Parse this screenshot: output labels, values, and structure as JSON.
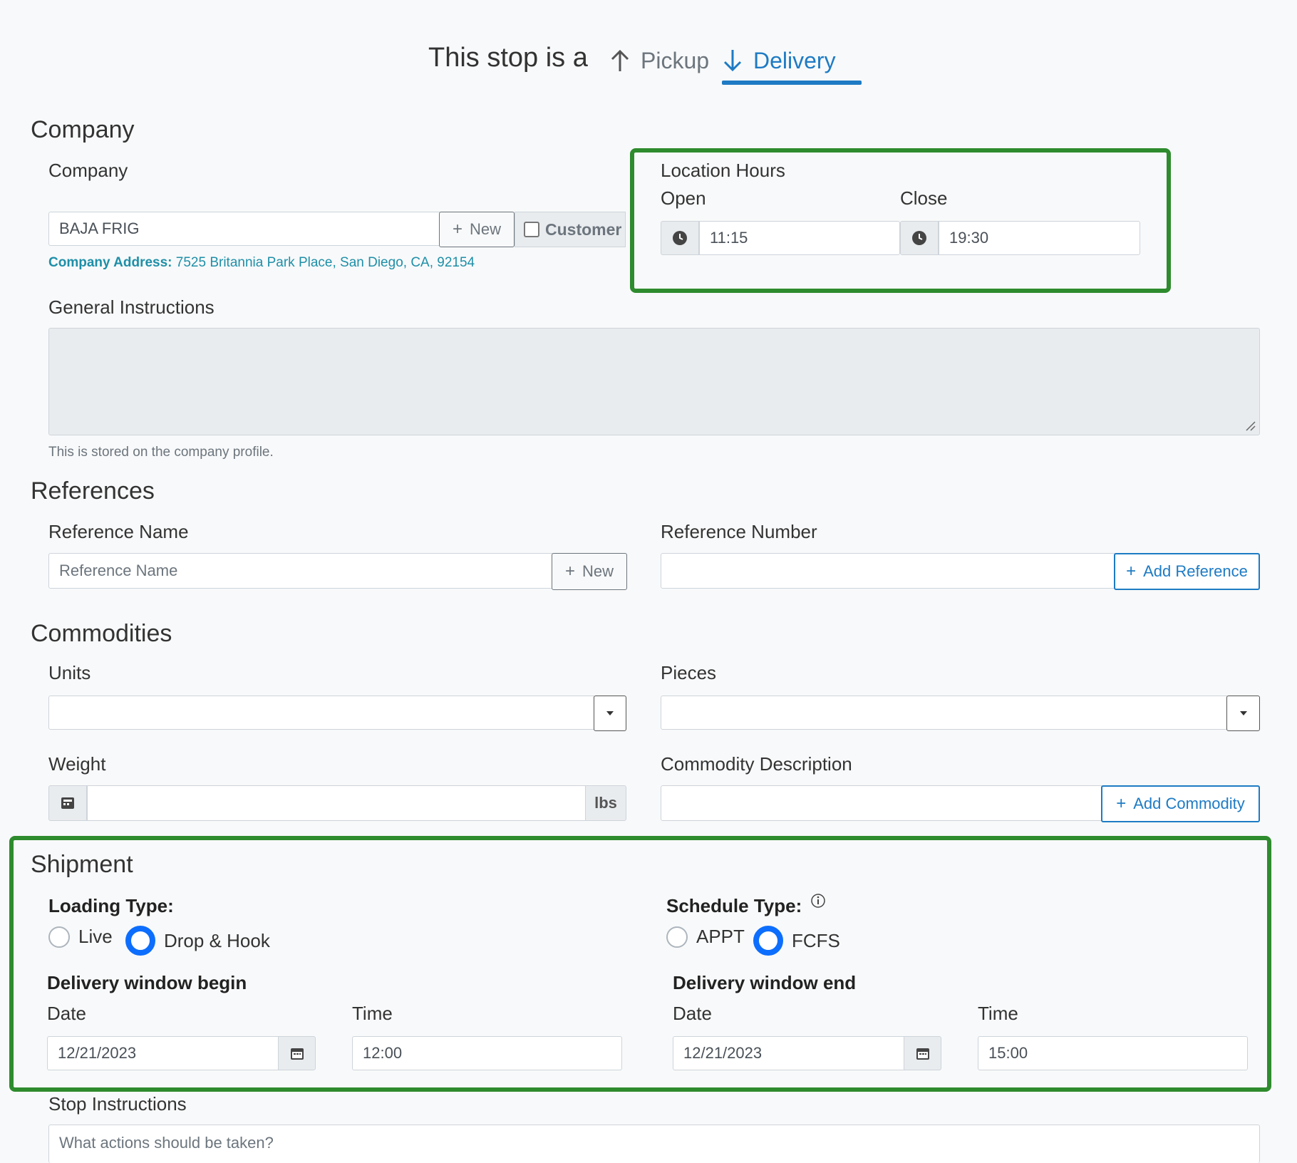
{
  "header": {
    "prefix": "This stop is a",
    "pickup_label": "Pickup",
    "delivery_label": "Delivery"
  },
  "company": {
    "section_title": "Company",
    "field_label": "Company",
    "value": "BAJA FRIG",
    "new_label": "New",
    "customer_label": "Customer",
    "address_label": "Company Address:",
    "address_value": "7525 Britannia Park Place, San Diego, CA, 92154"
  },
  "location_hours": {
    "title": "Location Hours",
    "open_label": "Open",
    "close_label": "Close",
    "open_value": "11:15",
    "close_value": "19:30"
  },
  "general_instructions": {
    "label": "General Instructions",
    "help": "This is stored on the company profile."
  },
  "references": {
    "section_title": "References",
    "name_label": "Reference Name",
    "name_placeholder": "Reference Name",
    "new_label": "New",
    "number_label": "Reference Number",
    "add_label": "Add Reference"
  },
  "commodities": {
    "section_title": "Commodities",
    "units_label": "Units",
    "pieces_label": "Pieces",
    "weight_label": "Weight",
    "weight_unit": "lbs",
    "description_label": "Commodity Description",
    "add_label": "Add Commodity"
  },
  "shipment": {
    "section_title": "Shipment",
    "loading_type_label": "Loading Type:",
    "loading_options": [
      "Live",
      "Drop & Hook"
    ],
    "loading_selected": "Drop & Hook",
    "schedule_type_label": "Schedule Type:",
    "schedule_options": [
      "APPT",
      "FCFS"
    ],
    "schedule_selected": "FCFS",
    "window_begin_label": "Delivery window begin",
    "window_end_label": "Delivery window end",
    "date_label": "Date",
    "time_label": "Time",
    "begin_date": "12/21/2023",
    "begin_time": "12:00",
    "end_date": "12/21/2023",
    "end_time": "15:00"
  },
  "stop_instructions": {
    "label": "Stop Instructions",
    "placeholder": "What actions should be taken?"
  },
  "colors": {
    "accent": "#1e7bc4",
    "highlight": "#2e8b2e",
    "radio_checked": "#0d6efd"
  }
}
